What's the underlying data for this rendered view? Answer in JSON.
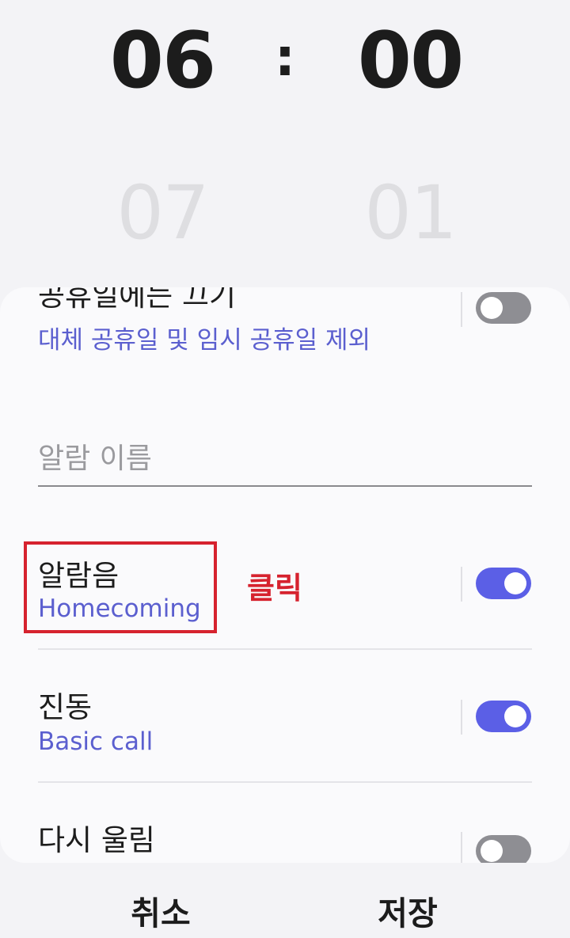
{
  "time_picker": {
    "hour": "06",
    "minute": "00",
    "separator": ":",
    "next_hour": "07",
    "next_minute": "01"
  },
  "settings": {
    "holiday": {
      "title": "공휴일에는 끄기",
      "subtitle": "대체 공휴일 및 임시 공휴일 제외",
      "enabled": false
    },
    "alarm_name": {
      "placeholder": "알람 이름",
      "value": ""
    },
    "alarm_sound": {
      "title": "알람음",
      "subtitle": "Homecoming",
      "enabled": true
    },
    "vibration": {
      "title": "진동",
      "subtitle": "Basic call",
      "enabled": true
    },
    "snooze": {
      "title": "다시 울림",
      "enabled": false
    }
  },
  "annotation": {
    "label": "클릭"
  },
  "footer": {
    "cancel_label": "취소",
    "save_label": "저장"
  },
  "colors": {
    "accent": "#5b5fe6",
    "subtitle": "#5b5fcf",
    "highlight": "#d6222e",
    "toggle_off": "#8e8e93"
  }
}
